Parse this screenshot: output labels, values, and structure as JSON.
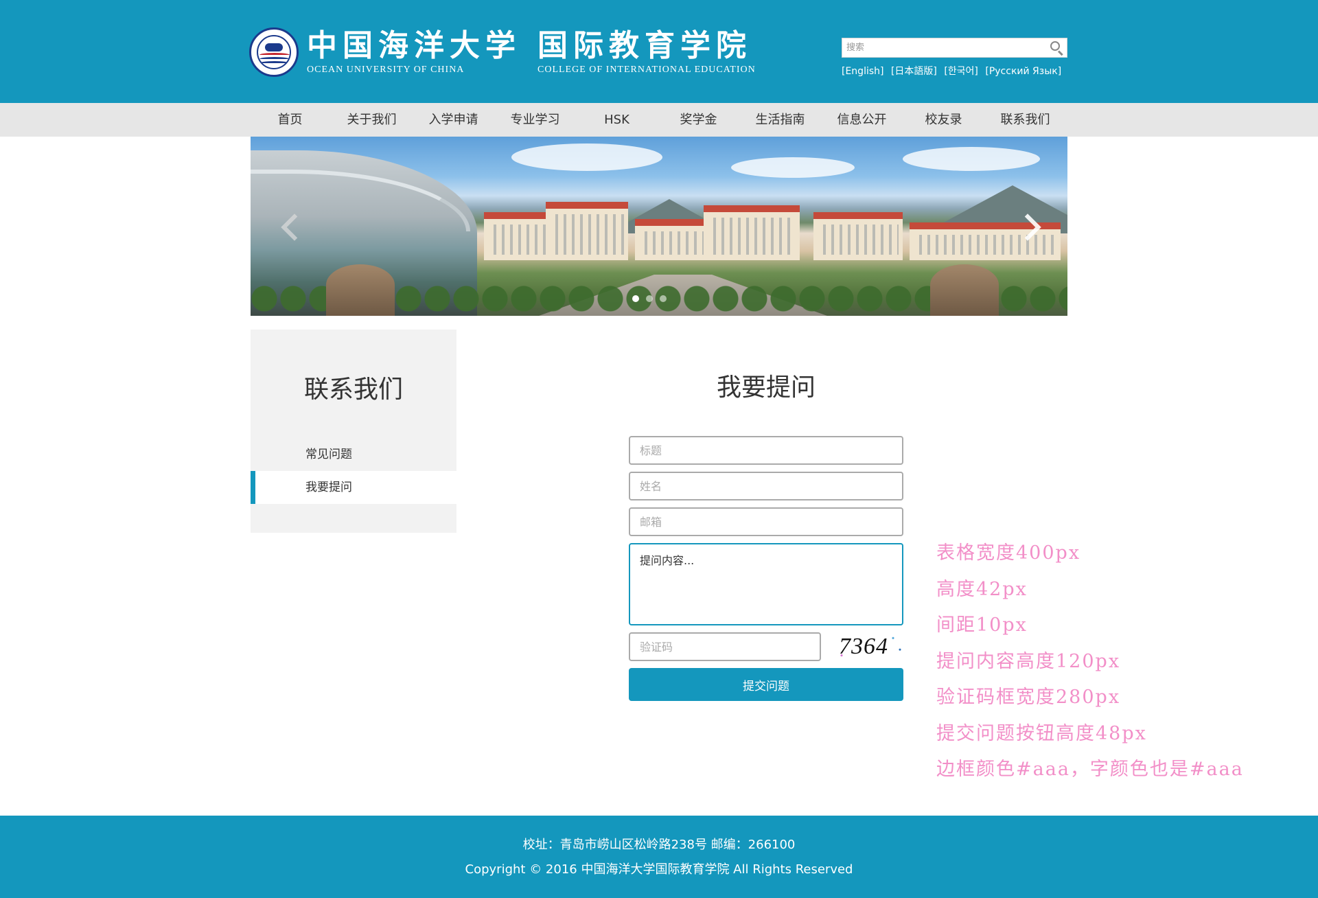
{
  "header": {
    "university_name_cn": "中国海洋大学",
    "university_name_en": "OCEAN UNIVERSITY OF CHINA",
    "college_name_cn": "国际教育学院",
    "college_name_en": "COLLEGE OF INTERNATIONAL EDUCATION",
    "logo_icon": "university-seal-icon",
    "search": {
      "placeholder": "搜索",
      "value": "",
      "icon": "search-icon"
    },
    "languages": [
      "[English]",
      "[日本語版]",
      "[한국어]",
      "[Русский Язык]"
    ]
  },
  "nav": {
    "items": [
      "首页",
      "关于我们",
      "入学申请",
      "专业学习",
      "HSK",
      "奖学金",
      "生活指南",
      "信息公开",
      "校友录",
      "联系我们"
    ]
  },
  "banner": {
    "slide_count": 3,
    "active_slide": 1,
    "prev_icon": "chevron-left-icon",
    "next_icon": "chevron-right-icon"
  },
  "sidebar": {
    "title": "联系我们",
    "items": [
      "常见问题",
      "我要提问"
    ],
    "active_index": 1
  },
  "form": {
    "title": "我要提问",
    "title_placeholder": "标题",
    "name_placeholder": "姓名",
    "email_placeholder": "邮箱",
    "content_placeholder": "提问内容...",
    "captcha_placeholder": "验证码",
    "captcha_text": "7364",
    "submit_label": "提交问题"
  },
  "notes": [
    "表格宽度400px",
    "高度42px",
    "间距10px",
    "提问内容高度120px",
    "验证码框宽度280px",
    "提交问题按钮高度48px",
    "边框颜色#aaa，字颜色也是#aaa"
  ],
  "footer": {
    "address": "校址：青岛市崂山区松岭路238号  邮编：266100",
    "copyright": "Copyright © 2016 中国海洋大学国际教育学院  All Rights Reserved"
  },
  "colors": {
    "brand": "#1497bd",
    "nav_bg": "#e6e6e6",
    "sidebar_bg": "#f2f2f2",
    "field_border": "#aaaaaa",
    "note_color": "#f28fc8"
  }
}
